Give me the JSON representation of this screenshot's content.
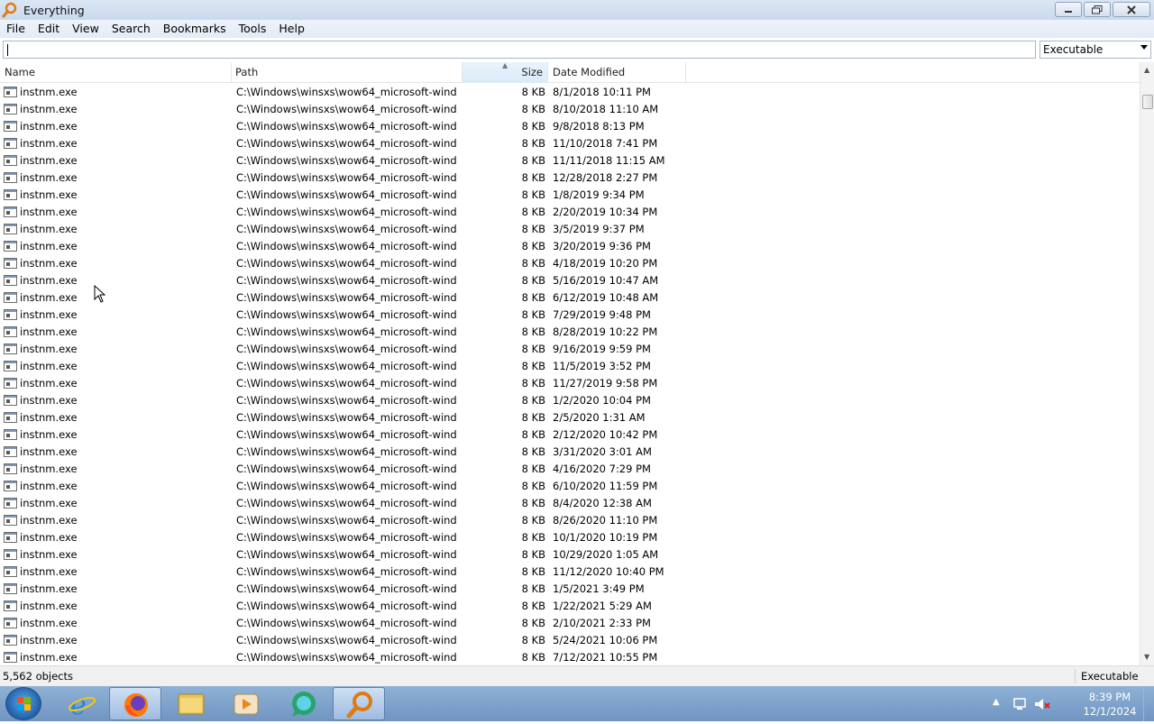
{
  "window": {
    "title": "Everything"
  },
  "menu": [
    "File",
    "Edit",
    "View",
    "Search",
    "Bookmarks",
    "Tools",
    "Help"
  ],
  "search": {
    "value": "",
    "filter": "Executable"
  },
  "columns": {
    "name": "Name",
    "path": "Path",
    "size": "Size",
    "date": "Date Modified"
  },
  "rows": [
    {
      "name": "instnm.exe",
      "path": "C:\\Windows\\winsxs\\wow64_microsoft-wind...",
      "size": "8 KB",
      "date": "8/1/2018 10:11 PM"
    },
    {
      "name": "instnm.exe",
      "path": "C:\\Windows\\winsxs\\wow64_microsoft-wind...",
      "size": "8 KB",
      "date": "8/10/2018 11:10 AM"
    },
    {
      "name": "instnm.exe",
      "path": "C:\\Windows\\winsxs\\wow64_microsoft-wind...",
      "size": "8 KB",
      "date": "9/8/2018 8:13 PM"
    },
    {
      "name": "instnm.exe",
      "path": "C:\\Windows\\winsxs\\wow64_microsoft-wind...",
      "size": "8 KB",
      "date": "11/10/2018 7:41 PM"
    },
    {
      "name": "instnm.exe",
      "path": "C:\\Windows\\winsxs\\wow64_microsoft-wind...",
      "size": "8 KB",
      "date": "11/11/2018 11:15 AM"
    },
    {
      "name": "instnm.exe",
      "path": "C:\\Windows\\winsxs\\wow64_microsoft-wind...",
      "size": "8 KB",
      "date": "12/28/2018 2:27 PM"
    },
    {
      "name": "instnm.exe",
      "path": "C:\\Windows\\winsxs\\wow64_microsoft-wind...",
      "size": "8 KB",
      "date": "1/8/2019 9:34 PM"
    },
    {
      "name": "instnm.exe",
      "path": "C:\\Windows\\winsxs\\wow64_microsoft-wind...",
      "size": "8 KB",
      "date": "2/20/2019 10:34 PM"
    },
    {
      "name": "instnm.exe",
      "path": "C:\\Windows\\winsxs\\wow64_microsoft-wind...",
      "size": "8 KB",
      "date": "3/5/2019 9:37 PM"
    },
    {
      "name": "instnm.exe",
      "path": "C:\\Windows\\winsxs\\wow64_microsoft-wind...",
      "size": "8 KB",
      "date": "3/20/2019 9:36 PM"
    },
    {
      "name": "instnm.exe",
      "path": "C:\\Windows\\winsxs\\wow64_microsoft-wind...",
      "size": "8 KB",
      "date": "4/18/2019 10:20 PM"
    },
    {
      "name": "instnm.exe",
      "path": "C:\\Windows\\winsxs\\wow64_microsoft-wind...",
      "size": "8 KB",
      "date": "5/16/2019 10:47 AM"
    },
    {
      "name": "instnm.exe",
      "path": "C:\\Windows\\winsxs\\wow64_microsoft-wind...",
      "size": "8 KB",
      "date": "6/12/2019 10:48 AM"
    },
    {
      "name": "instnm.exe",
      "path": "C:\\Windows\\winsxs\\wow64_microsoft-wind...",
      "size": "8 KB",
      "date": "7/29/2019 9:48 PM"
    },
    {
      "name": "instnm.exe",
      "path": "C:\\Windows\\winsxs\\wow64_microsoft-wind...",
      "size": "8 KB",
      "date": "8/28/2019 10:22 PM"
    },
    {
      "name": "instnm.exe",
      "path": "C:\\Windows\\winsxs\\wow64_microsoft-wind...",
      "size": "8 KB",
      "date": "9/16/2019 9:59 PM"
    },
    {
      "name": "instnm.exe",
      "path": "C:\\Windows\\winsxs\\wow64_microsoft-wind...",
      "size": "8 KB",
      "date": "11/5/2019 3:52 PM"
    },
    {
      "name": "instnm.exe",
      "path": "C:\\Windows\\winsxs\\wow64_microsoft-wind...",
      "size": "8 KB",
      "date": "11/27/2019 9:58 PM"
    },
    {
      "name": "instnm.exe",
      "path": "C:\\Windows\\winsxs\\wow64_microsoft-wind...",
      "size": "8 KB",
      "date": "1/2/2020 10:04 PM"
    },
    {
      "name": "instnm.exe",
      "path": "C:\\Windows\\winsxs\\wow64_microsoft-wind...",
      "size": "8 KB",
      "date": "2/5/2020 1:31 AM"
    },
    {
      "name": "instnm.exe",
      "path": "C:\\Windows\\winsxs\\wow64_microsoft-wind...",
      "size": "8 KB",
      "date": "2/12/2020 10:42 PM"
    },
    {
      "name": "instnm.exe",
      "path": "C:\\Windows\\winsxs\\wow64_microsoft-wind...",
      "size": "8 KB",
      "date": "3/31/2020 3:01 AM"
    },
    {
      "name": "instnm.exe",
      "path": "C:\\Windows\\winsxs\\wow64_microsoft-wind...",
      "size": "8 KB",
      "date": "4/16/2020 7:29 PM"
    },
    {
      "name": "instnm.exe",
      "path": "C:\\Windows\\winsxs\\wow64_microsoft-wind...",
      "size": "8 KB",
      "date": "6/10/2020 11:59 PM"
    },
    {
      "name": "instnm.exe",
      "path": "C:\\Windows\\winsxs\\wow64_microsoft-wind...",
      "size": "8 KB",
      "date": "8/4/2020 12:38 AM"
    },
    {
      "name": "instnm.exe",
      "path": "C:\\Windows\\winsxs\\wow64_microsoft-wind...",
      "size": "8 KB",
      "date": "8/26/2020 11:10 PM"
    },
    {
      "name": "instnm.exe",
      "path": "C:\\Windows\\winsxs\\wow64_microsoft-wind...",
      "size": "8 KB",
      "date": "10/1/2020 10:19 PM"
    },
    {
      "name": "instnm.exe",
      "path": "C:\\Windows\\winsxs\\wow64_microsoft-wind...",
      "size": "8 KB",
      "date": "10/29/2020 1:05 AM"
    },
    {
      "name": "instnm.exe",
      "path": "C:\\Windows\\winsxs\\wow64_microsoft-wind...",
      "size": "8 KB",
      "date": "11/12/2020 10:40 PM"
    },
    {
      "name": "instnm.exe",
      "path": "C:\\Windows\\winsxs\\wow64_microsoft-wind...",
      "size": "8 KB",
      "date": "1/5/2021 3:49 PM"
    },
    {
      "name": "instnm.exe",
      "path": "C:\\Windows\\winsxs\\wow64_microsoft-wind...",
      "size": "8 KB",
      "date": "1/22/2021 5:29 AM"
    },
    {
      "name": "instnm.exe",
      "path": "C:\\Windows\\winsxs\\wow64_microsoft-wind...",
      "size": "8 KB",
      "date": "2/10/2021 2:33 PM"
    },
    {
      "name": "instnm.exe",
      "path": "C:\\Windows\\winsxs\\wow64_microsoft-wind...",
      "size": "8 KB",
      "date": "5/24/2021 10:06 PM"
    },
    {
      "name": "instnm.exe",
      "path": "C:\\Windows\\winsxs\\wow64_microsoft-wind...",
      "size": "8 KB",
      "date": "7/12/2021 10:55 PM"
    }
  ],
  "status": {
    "count": "5,562 objects",
    "filter": "Executable"
  },
  "taskbar": {
    "apps": [
      "internet-explorer-icon",
      "firefox-icon",
      "file-explorer-icon",
      "media-player-icon",
      "chat-app-icon",
      "everything-search-icon"
    ],
    "clock_time": "8:39 PM",
    "clock_date": "12/1/2024"
  },
  "colors": {
    "titlebar": "#c9d9ee",
    "taskbar": "#7fa3cc",
    "sorted_column": "#d9ebf9"
  }
}
